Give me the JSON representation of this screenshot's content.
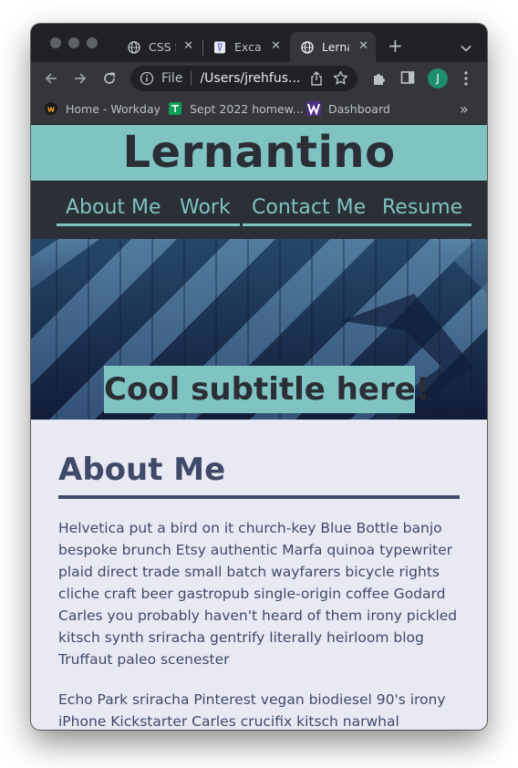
{
  "browser": {
    "tabs": [
      {
        "title": "CSS S",
        "icon": "globe-icon",
        "active": false
      },
      {
        "title": "Excal",
        "icon": "excalidraw-icon",
        "active": false
      },
      {
        "title": "Lerna",
        "icon": "globe-icon",
        "active": true
      }
    ],
    "omnibox": {
      "scheme_label": "File",
      "url": "/Users/jrehfus..."
    },
    "profile_initial": "J",
    "bookmarks": [
      {
        "label": "Home - Workday",
        "icon": "workday-icon"
      },
      {
        "label": "Sept 2022 homew...",
        "icon": "classroom-icon"
      },
      {
        "label": "Dashboard",
        "icon": "uw-icon"
      }
    ],
    "bookmarks_more": "»"
  },
  "site": {
    "title": "Lernantino",
    "nav": [
      "About Me",
      "Work",
      "Contact Me",
      "Resume"
    ],
    "hero_subtitle": "Cool subtitle here!",
    "section_title": "About Me",
    "paragraphs": [
      "Helvetica put a bird on it church-key Blue Bottle banjo bespoke brunch Etsy authentic Marfa quinoa typewriter plaid direct trade small batch wayfarers bicycle rights cliche craft beer gastropub single-origin coffee Godard Carles you probably haven't heard of them irony pickled kitsch synth sriracha gentrify literally heirloom blog Truffaut paleo scenester",
      "Echo Park sriracha Pinterest vegan biodiesel 90's irony iPhone Kickstarter Carles crucifix kitsch narwhal dreamcatcher"
    ]
  },
  "colors": {
    "accent": "#7fc3c2",
    "dark": "#2b2f36",
    "heading": "#3e4a68",
    "page_bg": "#e9e9f4"
  }
}
